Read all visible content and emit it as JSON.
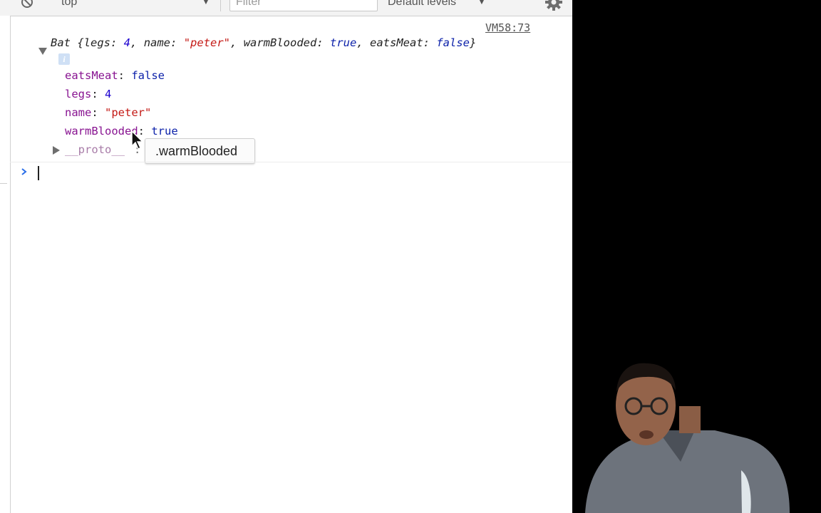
{
  "toolbar": {
    "context": "top",
    "filter_placeholder": "Filter",
    "levels": "Default levels"
  },
  "console": {
    "source_link": "VM58:73",
    "preview": {
      "class_name": "Bat",
      "open_brace": " {",
      "items": [
        {
          "key": "legs",
          "value": "4",
          "type": "number"
        },
        {
          "key": "name",
          "value": "\"peter\"",
          "type": "string"
        },
        {
          "key": "warmBlooded",
          "value": "true",
          "type": "boolean"
        },
        {
          "key": "eatsMeat",
          "value": "false",
          "type": "boolean"
        }
      ]
    },
    "properties": [
      {
        "key": "eatsMeat",
        "value": "false"
      },
      {
        "key": "legs",
        "value": "4"
      },
      {
        "key": "name",
        "value": "\"peter\""
      },
      {
        "key": "warmBlooded",
        "value": "true"
      }
    ],
    "proto_label": "__proto__",
    "proto_colon": ":",
    "tooltip": ".warmBlooded"
  },
  "icons": {
    "clear": "block-icon",
    "gear": "gear-icon",
    "cursor": "mouse-pointer-icon"
  }
}
